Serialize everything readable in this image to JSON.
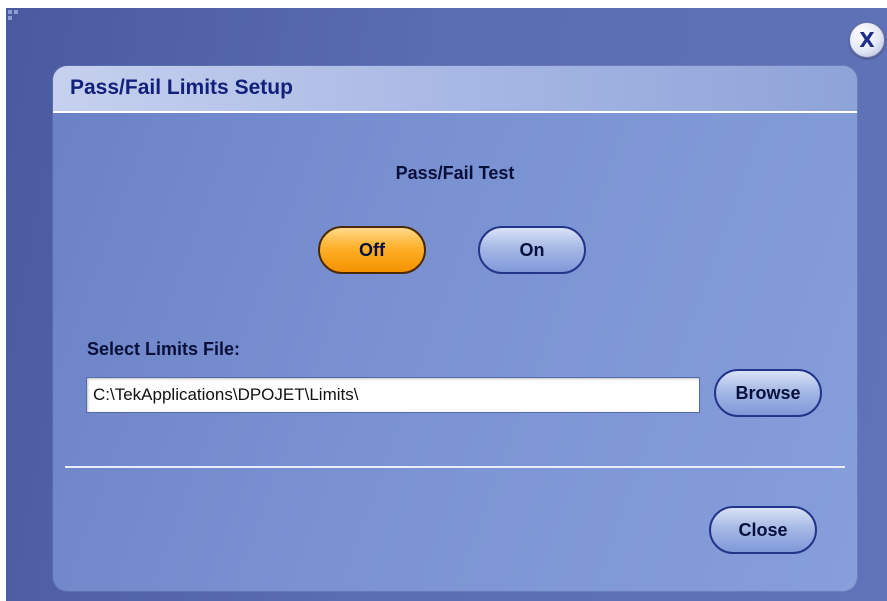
{
  "window": {
    "close_icon_glyph": "X"
  },
  "panel": {
    "title": "Pass/Fail Limits Setup"
  },
  "pass_fail_test": {
    "label": "Pass/Fail Test",
    "off_label": "Off",
    "on_label": "On",
    "selected": "Off"
  },
  "limits_file": {
    "label": "Select Limits File:",
    "path_value": "C:\\TekApplications\\DPOJET\\Limits\\",
    "browse_label": "Browse"
  },
  "footer": {
    "close_label": "Close"
  },
  "colors": {
    "background": "#5666ad",
    "panel": "#7a92d2",
    "title_text": "#12207a",
    "active_toggle": "#ffb02a",
    "button": "#a6b9e6"
  }
}
